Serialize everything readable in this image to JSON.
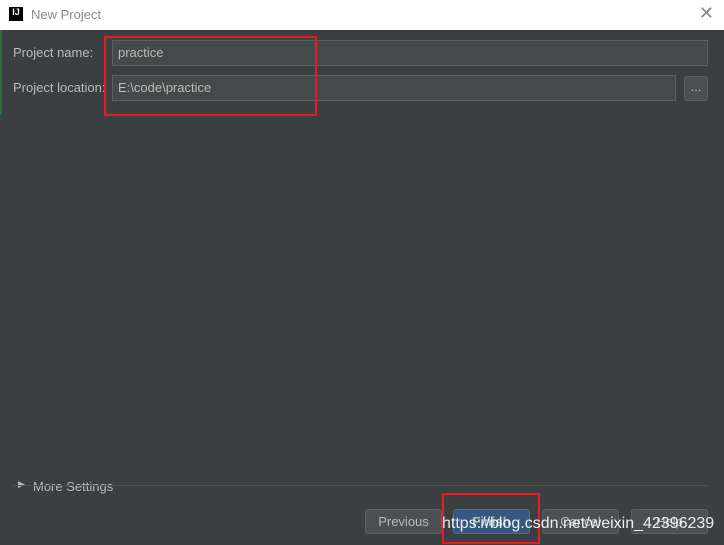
{
  "window": {
    "title": "New Project",
    "logo": "IJ"
  },
  "form": {
    "name_label": "Project name:",
    "name_value": "practice",
    "location_label": "Project location:",
    "location_value": "E:\\code\\practice",
    "browse_label": "..."
  },
  "more_settings": "More Settings",
  "buttons": {
    "previous": "Previous",
    "finish": "Finish",
    "cancel": "Cancel",
    "help": "Help"
  },
  "watermark": "https://blog.csdn.net/weixin_42396239",
  "colors": {
    "background": "#3c3f41",
    "primary_button": "#365880",
    "highlight": "#e51c23"
  }
}
